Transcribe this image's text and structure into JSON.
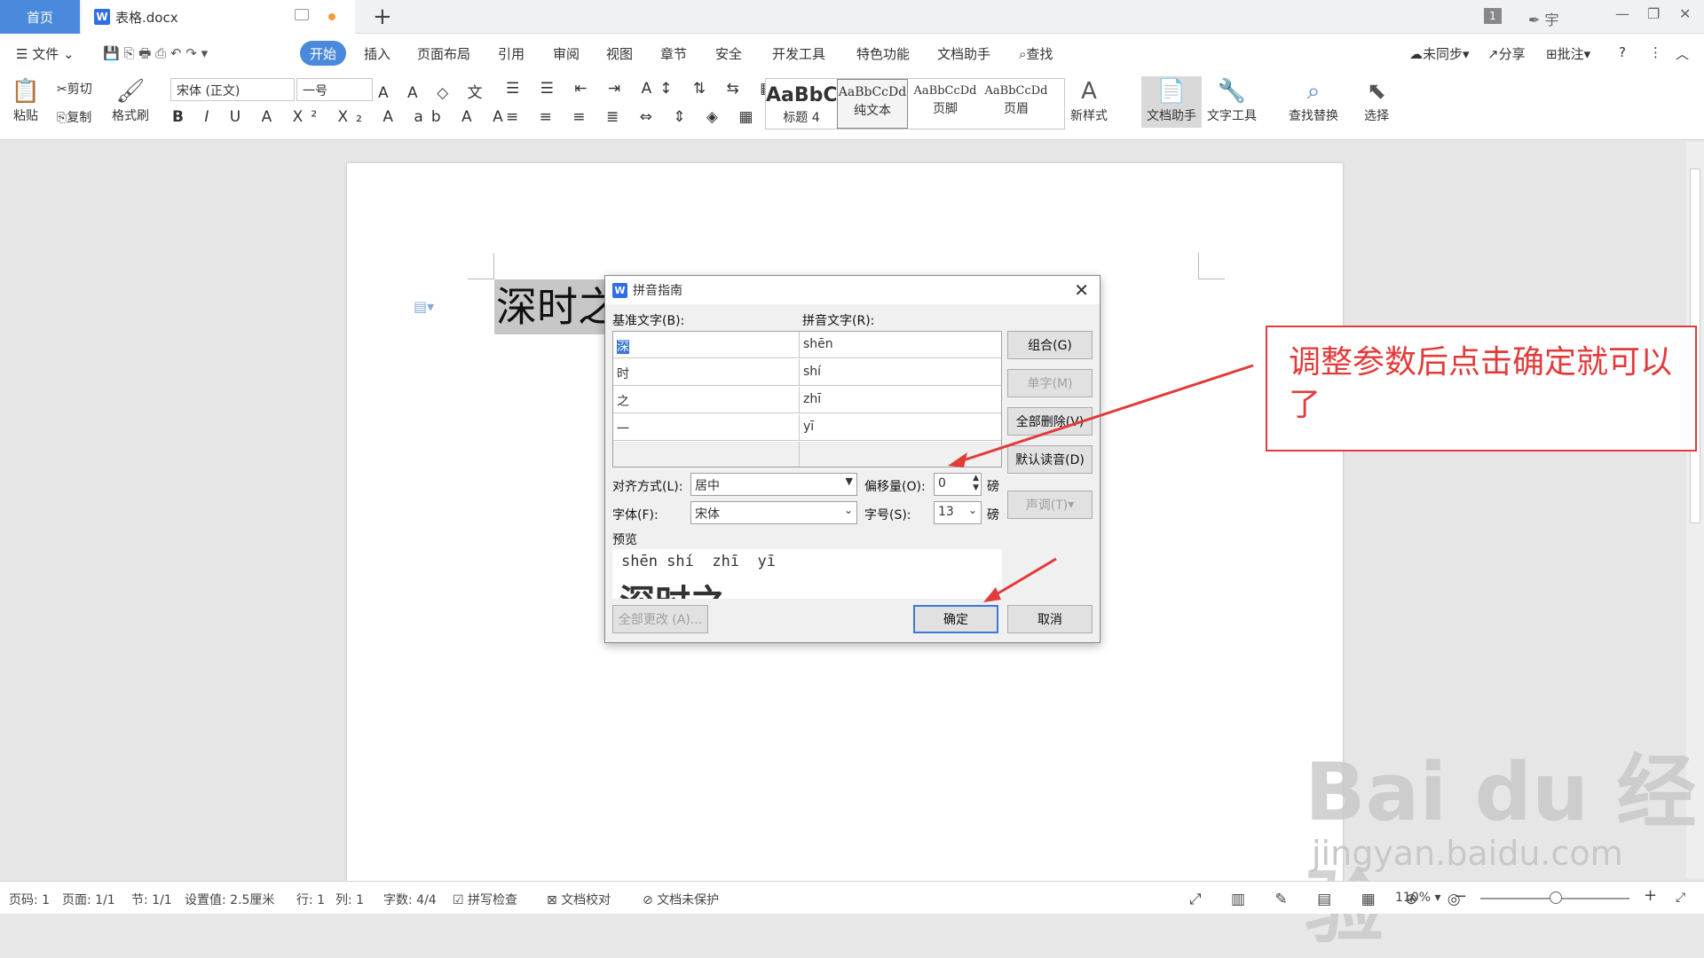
{
  "tabs": {
    "home": "首页",
    "doc": "表格.docx"
  },
  "titlebar": {
    "page_badge": "1",
    "user": "宇"
  },
  "menu": {
    "file": "文件",
    "start": "开始",
    "items": [
      "插入",
      "页面布局",
      "引用",
      "审阅",
      "视图",
      "章节",
      "安全",
      "开发工具",
      "特色功能",
      "文档助手",
      "查找"
    ],
    "sync": "未同步",
    "share": "分享",
    "comment": "批注"
  },
  "ribbon": {
    "paste": "粘贴",
    "cut": "剪切",
    "copy": "复制",
    "format_painter": "格式刷",
    "font_name": "宋体 (正文)",
    "font_size": "一号",
    "styles": [
      {
        "preview": "AaBbC",
        "label": "标题 4"
      },
      {
        "preview": "AaBbCcDd",
        "label": "纯文本"
      },
      {
        "preview": "AaBbCcDd",
        "label": "页脚"
      },
      {
        "preview": "AaBbCcDd",
        "label": "页眉"
      }
    ],
    "new_style": "新样式",
    "doc_helper": "文档助手",
    "text_tools": "文字工具",
    "find_replace": "查找替换",
    "select": "选择"
  },
  "document": {
    "text": "深时之"
  },
  "dialog": {
    "title": "拼音指南",
    "base_label": "基准文字(B):",
    "ruby_label": "拼音文字(R):",
    "rows": [
      {
        "base": "深",
        "ruby": "shēn"
      },
      {
        "base": "时",
        "ruby": "shí"
      },
      {
        "base": "之",
        "ruby": "zhī"
      },
      {
        "base": "一",
        "ruby": "yī"
      }
    ],
    "buttons": {
      "combine": "组合(G)",
      "single": "单字(M)",
      "clear_all": "全部删除(V)",
      "default_reading": "默认读音(D)",
      "tone": "声调(T)",
      "change_all": "全部更改 (A)...",
      "ok": "确定",
      "cancel": "取消"
    },
    "align_label": "对齐方式(L):",
    "align_value": "居中",
    "offset_label": "偏移量(O):",
    "offset_value": "0",
    "offset_unit": "磅",
    "font_label": "字体(F):",
    "font_value": "宋体",
    "size_label": "字号(S):",
    "size_value": "13",
    "size_unit": "磅",
    "preview_label": "预览",
    "preview_pinyin": "shēn shí  zhī  yī",
    "preview_text": "深时之一"
  },
  "annotation": {
    "text": "调整参数后点击确定就可以了"
  },
  "status": {
    "page_num": "页码: 1",
    "pages": "页面: 1/1",
    "section": "节: 1/1",
    "setting": "设置值: 2.5厘米",
    "row": "行: 1",
    "col": "列: 1",
    "words": "字数: 4/4",
    "spell": "拼写检查",
    "proofread": "文档校对",
    "protect": "文档未保护",
    "zoom": "110%"
  },
  "watermark": {
    "brand": "Bai du 经验",
    "url": "jingyan.baidu.com"
  },
  "colors": {
    "accent": "#4b89dc",
    "annotation": "#e23b3b"
  }
}
